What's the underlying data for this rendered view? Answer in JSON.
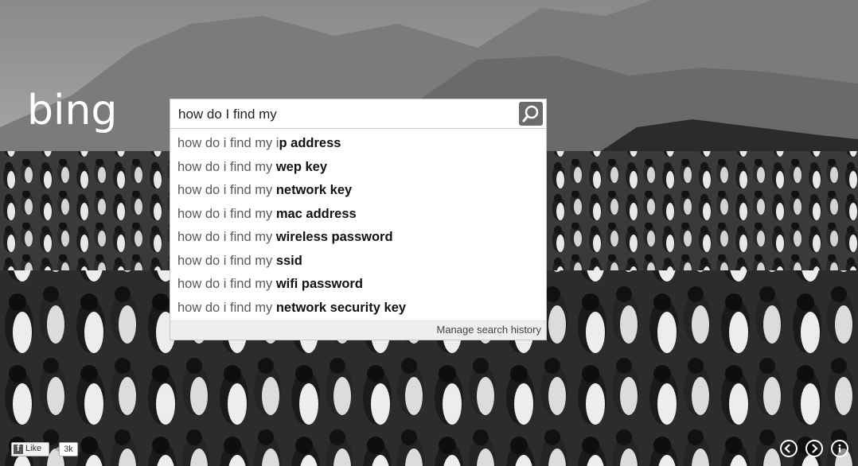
{
  "search": {
    "query": "how do I find my"
  },
  "suggestions": [
    {
      "prefix": "how do i find my i",
      "completion": "p address"
    },
    {
      "prefix": "how do i find my ",
      "completion": "wep key"
    },
    {
      "prefix": "how do i find my ",
      "completion": "network key"
    },
    {
      "prefix": "how do i find my ",
      "completion": "mac address"
    },
    {
      "prefix": "how do i find my ",
      "completion": "wireless password"
    },
    {
      "prefix": "how do i find my ",
      "completion": "ssid"
    },
    {
      "prefix": "how do i find my ",
      "completion": "wifi password"
    },
    {
      "prefix": "how do i find my ",
      "completion": "network security key"
    }
  ],
  "manage_history_label": "Manage search history",
  "facebook": {
    "icon_letter": "f",
    "like_label": "Like",
    "count": "3k"
  },
  "nav": {
    "prev_icon": "chevron-left-icon",
    "next_icon": "chevron-right-icon",
    "info_icon": "info-icon"
  },
  "logo": "bing",
  "colors": {
    "search_button": "#6b6b6b",
    "suggestion_bold": "#111111",
    "suggestion_prefix": "#595959"
  }
}
